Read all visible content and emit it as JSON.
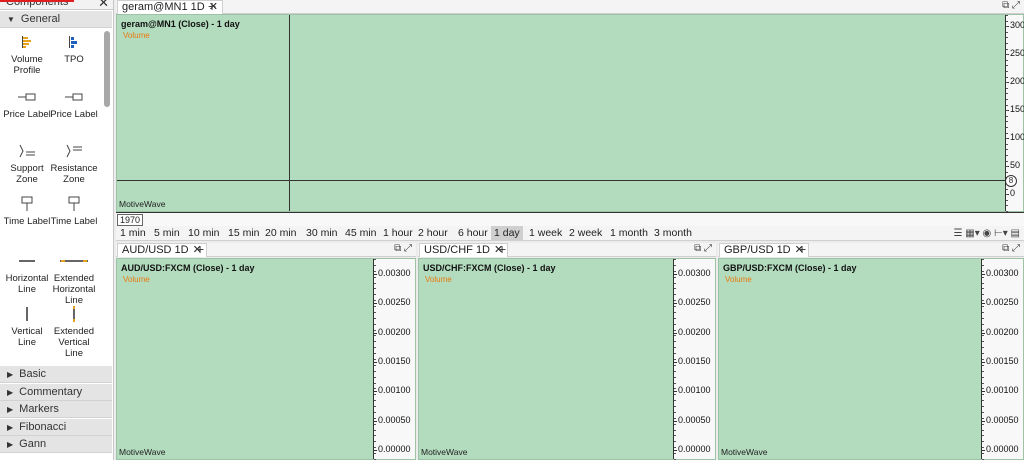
{
  "sidebar": {
    "title": "Components",
    "general_label": "General",
    "items": [
      {
        "label": "Volume Profile",
        "icon": "volume-profile-icon"
      },
      {
        "label": "TPO",
        "icon": "tpo-icon"
      },
      {
        "label": "Price Label",
        "icon": "price-label-icon"
      },
      {
        "label": "Price Label",
        "icon": "price-label-icon"
      },
      {
        "label": "Support Zone",
        "icon": "support-zone-icon"
      },
      {
        "label": "Resistance Zone",
        "icon": "resistance-zone-icon"
      },
      {
        "label": "Time Label",
        "icon": "time-label-icon"
      },
      {
        "label": "Time Label",
        "icon": "time-label-icon"
      },
      {
        "label": "Horizontal Line",
        "icon": "horizontal-line-icon"
      },
      {
        "label": "Extended Horizontal Line",
        "icon": "extended-horizontal-line-icon"
      },
      {
        "label": "Vertical Line",
        "icon": "vertical-line-icon"
      },
      {
        "label": "Extended Vertical Line",
        "icon": "extended-vertical-line-icon"
      }
    ],
    "groups": [
      "Basic",
      "Commentary",
      "Markers",
      "Fibonacci",
      "Gann"
    ]
  },
  "main_chart": {
    "tab": "geram@MN1 1D",
    "title": "geram@MN1 (Close) - 1 day",
    "volume": "Volume",
    "brand": "MotiveWave",
    "year": "1970",
    "axis_labels": [
      "300",
      "250",
      "200",
      "150",
      "100",
      "50",
      "0"
    ],
    "axis_values": [
      300,
      250,
      200,
      150,
      100,
      50,
      0
    ],
    "ylim": [
      -30,
      320
    ]
  },
  "timeframes": [
    "1 min",
    "5 min",
    "10 min",
    "15 min",
    "20 min",
    "30 min",
    "45 min",
    "1 hour",
    "2 hour",
    "6 hour",
    "1 day",
    "1 week",
    "2 week",
    "1 month",
    "3 month"
  ],
  "selected_timeframe": "1 day",
  "sub_charts": [
    {
      "tab": "AUD/USD 1D",
      "title": "AUD/USD:FXCM (Close) - 1 day",
      "volume": "Volume",
      "brand": "MotiveWave"
    },
    {
      "tab": "USD/CHF 1D",
      "title": "USD/CHF:FXCM (Close) - 1 day",
      "volume": "Volume",
      "brand": "MotiveWave"
    },
    {
      "tab": "GBP/USD 1D",
      "title": "GBP/USD:FXCM (Close) - 1 day",
      "volume": "Volume",
      "brand": "MotiveWave"
    }
  ],
  "sub_axis": {
    "labels": [
      "0.00300",
      "0.00250",
      "0.00200",
      "0.00150",
      "0.00100",
      "0.00050",
      "0.00000"
    ],
    "values": [
      0.003,
      0.0025,
      0.002,
      0.0015,
      0.001,
      0.0005,
      0
    ],
    "ylim": [
      -0.00015,
      0.00325
    ]
  },
  "colors": {
    "plot_bg": "#b3dbbd",
    "volume": "#e87a10",
    "selected_tf": "#cfcfcf"
  }
}
